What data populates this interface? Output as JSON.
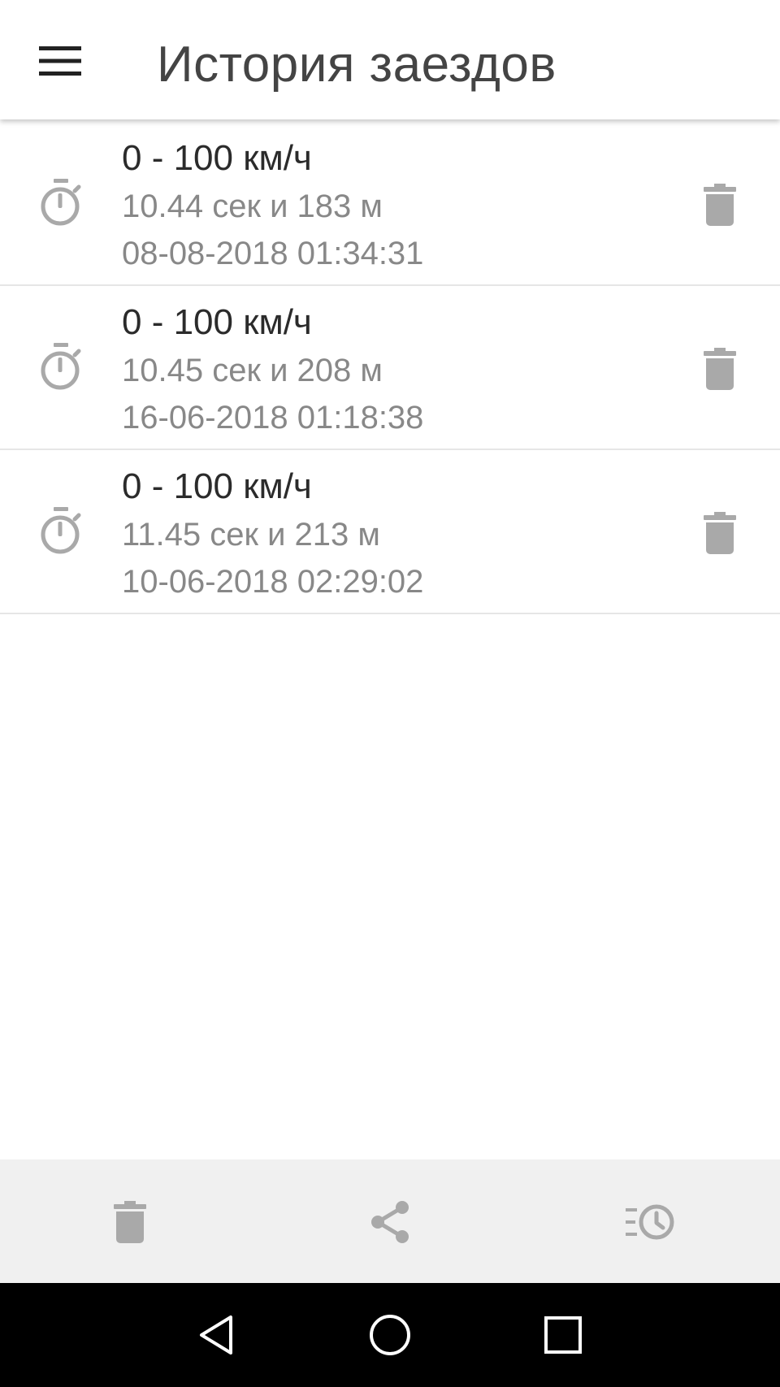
{
  "appbar": {
    "title": "История заездов",
    "menu_icon": "menu-icon"
  },
  "runs": [
    {
      "title": "0 - 100 км/ч",
      "result": "10.44 сек и 183 м",
      "datetime": "08-08-2018 01:34:31",
      "icon": "stopwatch-icon",
      "delete_icon": "trash-icon"
    },
    {
      "title": "0 - 100 км/ч",
      "result": "10.45 сек и 208 м",
      "datetime": "16-06-2018 01:18:38",
      "icon": "stopwatch-icon",
      "delete_icon": "trash-icon"
    },
    {
      "title": "0 - 100 км/ч",
      "result": "11.45 сек и 213 м",
      "datetime": "10-06-2018 02:29:02",
      "icon": "stopwatch-icon",
      "delete_icon": "trash-icon"
    }
  ],
  "bottom_actions": [
    "trash-icon",
    "share-icon",
    "history-icon"
  ],
  "system_nav": [
    "back-icon",
    "home-icon",
    "recents-icon"
  ],
  "colors": {
    "icon_gray": "#a9a9a9",
    "title_text": "#444444",
    "primary_text": "#2b2b2b",
    "secondary_text": "#888888",
    "divider": "#e6e6e6",
    "bottom_bar": "#f0f0f0",
    "nav_bar": "#000000"
  }
}
